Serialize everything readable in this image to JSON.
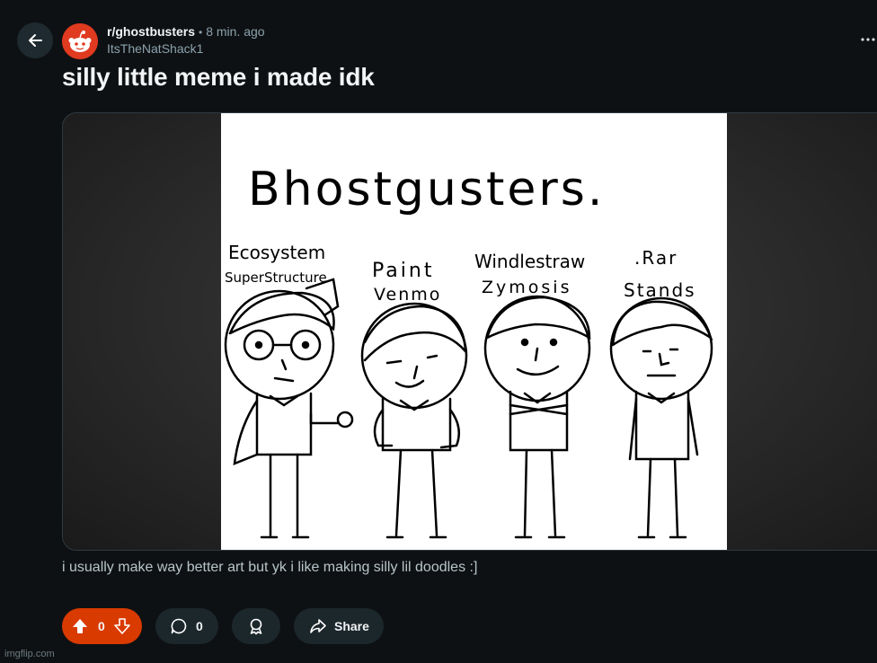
{
  "post": {
    "subreddit": "r/ghostbusters",
    "separator": "•",
    "time": "8 min. ago",
    "author": "ItsTheNatShack1",
    "title": "silly little meme i made idk",
    "body": "i usually make way better art but yk i like making silly lil doodles :]"
  },
  "image": {
    "heading": "Bhostgusters.",
    "characters": [
      {
        "line1": "Ecosystem",
        "line2": "SuperStructure"
      },
      {
        "line1": "Paint",
        "line2": "Venmo"
      },
      {
        "line1": "Windlestraw",
        "line2": "Zymosis"
      },
      {
        "line1": ".Rar",
        "line2": "Stands"
      }
    ]
  },
  "actions": {
    "vote_count": "0",
    "comment_count": "0",
    "share_label": "Share"
  },
  "watermark": "imgflip.com",
  "icons": {
    "back": "arrow-left-icon",
    "more": "more-horizontal-icon",
    "upvote": "upvote-arrow-icon",
    "downvote": "downvote-arrow-icon",
    "comment": "comment-bubble-icon",
    "award": "award-ribbon-icon",
    "share": "share-arrow-icon"
  },
  "colors": {
    "background": "#0e1113",
    "vote_active": "#d93a00",
    "button_bg": "#1c272c",
    "subreddit_avatar": "#e03a20"
  }
}
